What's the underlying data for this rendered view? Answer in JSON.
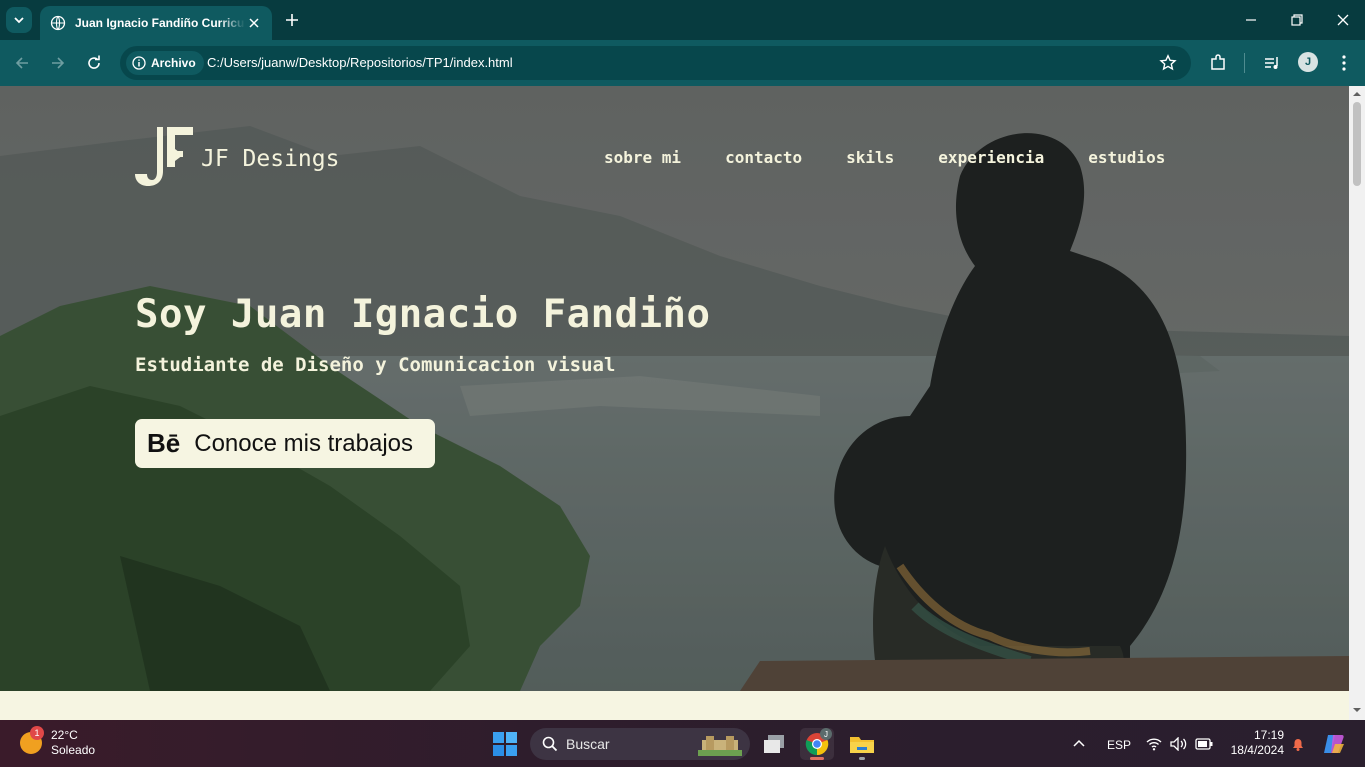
{
  "browser": {
    "tab_title": "Juan Ignacio Fandiño Curriculum",
    "security_chip": "Archivo",
    "url": "C:/Users/juanw/Desktop/Repositorios/TP1/index.html",
    "profile_initial": "J"
  },
  "site": {
    "logo_text": "JF Desings",
    "nav": [
      "sobre mi",
      "contacto",
      "skils",
      "experiencia",
      "estudios"
    ],
    "heading": "Soy Juan Ignacio Fandiño",
    "subheading": "Estudiante de Diseño y Comunicacion visual",
    "cta_icon": "Bē",
    "cta_label": "Conoce mis trabajos"
  },
  "taskbar": {
    "weather_badge": "1",
    "weather_temp": "22°C",
    "weather_desc": "Soleado",
    "search_placeholder": "Buscar",
    "chrome_badge": "J",
    "language": "ESP",
    "time": "17:19",
    "date": "18/4/2024"
  },
  "colors": {
    "browser_frame": "#0f5a60",
    "tabstrip": "#073b3f",
    "site_text": "#f4f3dc",
    "page_bg": "#f6f5e2"
  }
}
